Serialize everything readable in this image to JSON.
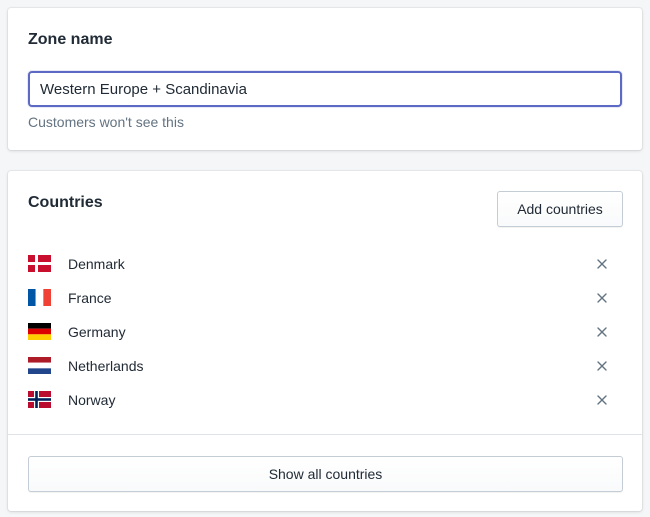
{
  "zone": {
    "title": "Zone name",
    "input_value": "Western Europe + Scandinavia",
    "help_text": "Customers won't see this"
  },
  "countries_section": {
    "title": "Countries",
    "add_button_label": "Add countries",
    "show_all_label": "Show all countries",
    "items": [
      {
        "name": "Denmark",
        "flag_icon": "denmark-flag-icon"
      },
      {
        "name": "France",
        "flag_icon": "france-flag-icon"
      },
      {
        "name": "Germany",
        "flag_icon": "germany-flag-icon"
      },
      {
        "name": "Netherlands",
        "flag_icon": "netherlands-flag-icon"
      },
      {
        "name": "Norway",
        "flag_icon": "norway-flag-icon"
      }
    ]
  },
  "colors": {
    "focus_border": "#5c6ac4",
    "text": "#212b36",
    "subdued_text": "#637381",
    "page_bg": "#f4f6f8",
    "remove_icon": "#637381"
  }
}
